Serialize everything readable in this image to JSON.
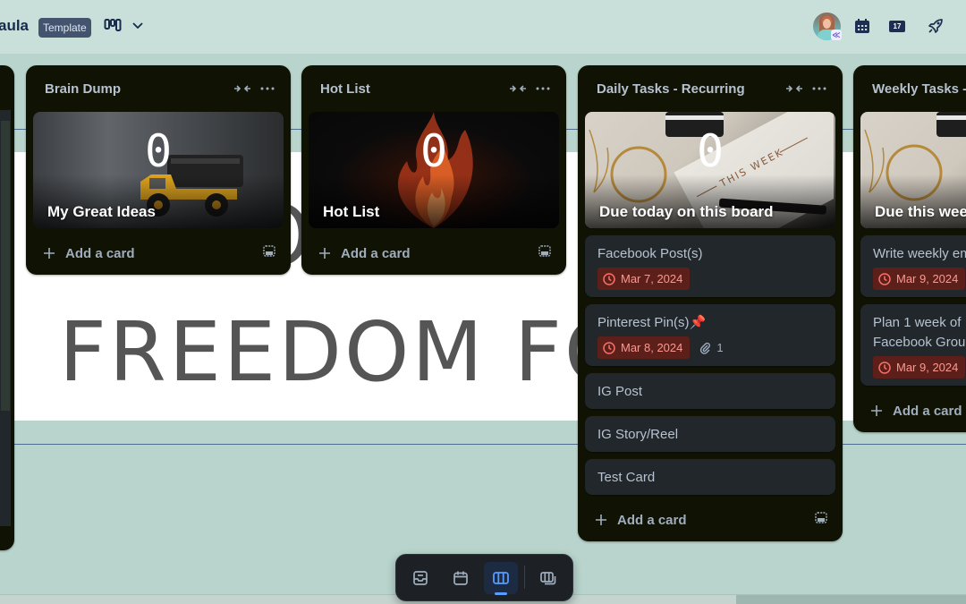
{
  "header": {
    "board_name": "aula",
    "template_badge": "Template",
    "view_switch_icon": "board-view-icon",
    "right_icons": [
      "avatar",
      "calendar-icon",
      "calendar-17-icon",
      "rocket-icon"
    ],
    "calendar_badge": "17",
    "avatar_badge": "≪"
  },
  "banner": {
    "text": "FREEDOM FO",
    "text_top": "OOL"
  },
  "lists": [
    {
      "title": "Brain Dump",
      "cover": {
        "count": "0",
        "title": "My Great Ideas",
        "image": "toy-truck"
      },
      "cards": [],
      "add_label": "Add a card"
    },
    {
      "title": "Hot List",
      "cover": {
        "count": "0",
        "title": "Hot List",
        "image": "fire"
      },
      "cards": [],
      "add_label": "Add a card"
    },
    {
      "title": "Daily Tasks - Recurring",
      "cover": {
        "count": "0",
        "title": "Due today on this board",
        "image": "this-week-planner"
      },
      "cards": [
        {
          "title": "Facebook Post(s)",
          "due": "Mar 7, 2024"
        },
        {
          "title": "Pinterest Pin(s)📌",
          "due": "Mar 8, 2024",
          "attachments": "1"
        },
        {
          "title": "IG Post"
        },
        {
          "title": "IG Story/Reel"
        },
        {
          "title": "Test Card"
        }
      ],
      "add_label": "Add a card"
    },
    {
      "title": "Weekly Tasks - ",
      "cover": {
        "count": "",
        "title": "Due this week",
        "image": "this-week-planner"
      },
      "cards": [
        {
          "title": "Write weekly em",
          "due": "Mar 9, 2024"
        },
        {
          "title": "Plan 1 week of Facebook Grou",
          "due": "Mar 9, 2024"
        }
      ],
      "add_label": "Add a card"
    }
  ],
  "view_switcher": {
    "items": [
      {
        "name": "inbox",
        "icon": "inbox-icon",
        "active": false
      },
      {
        "name": "planner",
        "icon": "calendar-icon",
        "active": false
      },
      {
        "name": "board",
        "icon": "board-icon",
        "active": true
      },
      {
        "name": "switch-boards",
        "icon": "switch-boards-icon",
        "active": false
      }
    ]
  },
  "colors": {
    "background": "#b8d4cc",
    "list_bg": "#101204",
    "card_bg": "#22272b",
    "due_bg": "#5d1f1a",
    "due_text": "#fd9891",
    "accent": "#579dff"
  }
}
